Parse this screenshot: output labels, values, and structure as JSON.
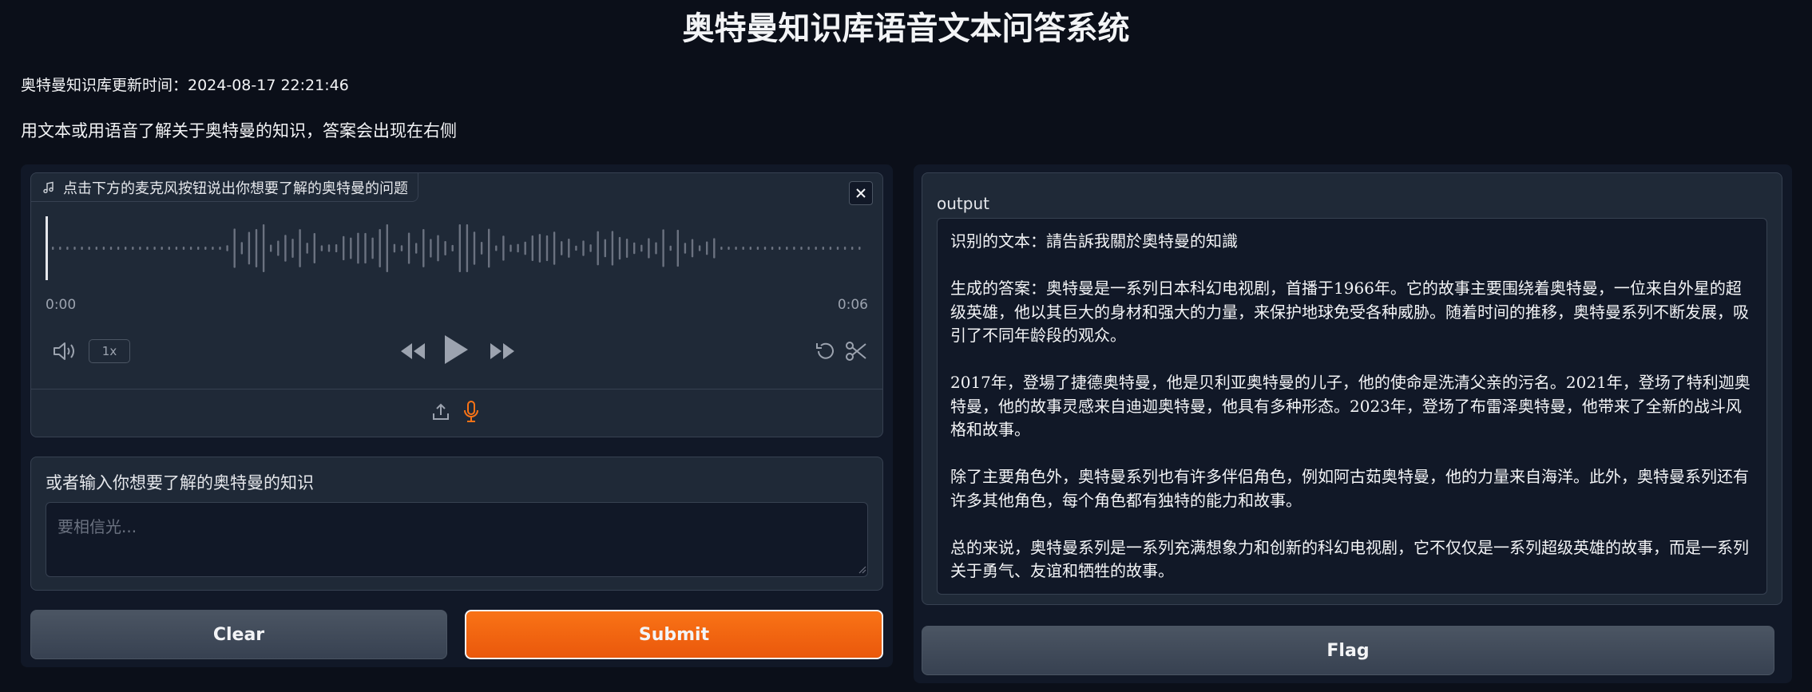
{
  "header": {
    "title": "奥特曼知识库语音文本问答系统",
    "update_time": "奥特曼知识库更新时间：2024-08-17 22:21:46",
    "description": "用文本或用语音了解关于奥特曼的知识，答案会出现在右侧"
  },
  "audio": {
    "label": "点击下方的麦克风按钮说出你想要了解的奥特曼的问题",
    "time_start": "0:00",
    "time_end": "0:06",
    "speed": "1x",
    "icons": [
      "music-note-icon",
      "close-icon",
      "volume-icon",
      "rewind-icon",
      "play-icon",
      "fast-forward-icon",
      "undo-icon",
      "scissors-icon",
      "upload-icon",
      "microphone-icon"
    ],
    "accent_color": "#f97316"
  },
  "text_input": {
    "label": "或者输入你想要了解的奥特曼的知识",
    "placeholder": "要相信光...",
    "value": ""
  },
  "buttons": {
    "clear": "Clear",
    "submit": "Submit",
    "flag": "Flag"
  },
  "output": {
    "label": "output",
    "text": "识别的文本：請告訴我關於奧特曼的知識\n\n生成的答案：奥特曼是一系列日本科幻电视剧，首播于1966年。它的故事主要围绕着奥特曼，一位来自外星的超级英雄，他以其巨大的身材和强大的力量，来保护地球免受各种威胁。随着时间的推移，奥特曼系列不断发展，吸引了不同年龄段的观众。\n\n2017年，登場了捷德奥特曼，他是贝利亚奥特曼的儿子，他的使命是洗清父亲的污名。2021年，登场了特利迦奥特曼，他的故事灵感来自迪迦奥特曼，他具有多种形态。2023年，登场了布雷泽奥特曼，他带来了全新的战斗风格和故事。\n\n除了主要角色外，奥特曼系列也有许多伴侣角色，例如阿古茹奥特曼，他的力量来自海洋。此外，奥特曼系列还有许多其他角色，每个角色都有独特的能力和故事。\n\n总的来说，奥特曼系列是一系列充满想象力和创新的科幻电视剧，它不仅仅是一系列超级英雄的故事，而是一系列关于勇气、友谊和牺牲的故事。"
  },
  "colors": {
    "background": "#0b0f19",
    "panel": "#111827",
    "block": "#1f2937",
    "submit": "#f97316"
  }
}
